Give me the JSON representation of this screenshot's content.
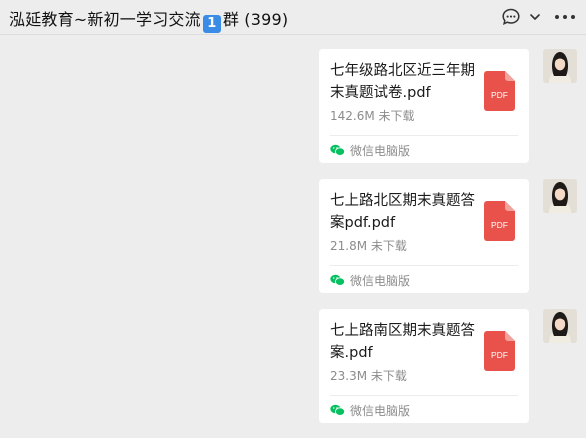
{
  "header": {
    "title_prefix": "泓延教育~新初一学习交流",
    "title_badge": "1",
    "title_suffix": "群 (399)",
    "icons": [
      "chat-bubble-icon",
      "chevron-down-icon",
      "more-horizontal-icon"
    ]
  },
  "messages": [
    {
      "file_name": "七年级路北区近三年期末真题试卷.pdf",
      "file_size": "142.6M",
      "status": "未下载",
      "file_type": "PDF",
      "source": "微信电脑版"
    },
    {
      "file_name": "七上路北区期末真题答案pdf.pdf",
      "file_size": "21.8M",
      "status": "未下载",
      "file_type": "PDF",
      "source": "微信电脑版"
    },
    {
      "file_name": "七上路南区期末真题答案.pdf",
      "file_size": "23.3M",
      "status": "未下载",
      "file_type": "PDF",
      "source": "微信电脑版"
    }
  ],
  "colors": {
    "background": "#ededed",
    "card": "#ffffff",
    "pdf_red": "#e8524a",
    "wechat_green": "#07c160",
    "secondary_text": "#8c8c8c"
  }
}
